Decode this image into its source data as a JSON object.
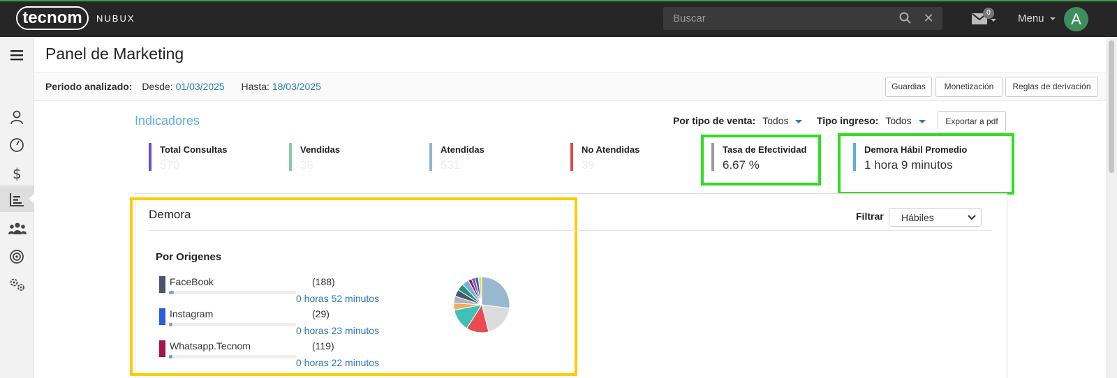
{
  "brand": {
    "logo": "tecnom",
    "product": "NUBUX"
  },
  "topbar": {
    "search_placeholder": "Buscar",
    "mail_count": "0",
    "menu_label": "Menu",
    "avatar_initial": "A"
  },
  "page": {
    "title": "Panel de Marketing"
  },
  "period": {
    "label": "Periodo analizado:",
    "from_label": "Desde:",
    "from_value": "01/03/2025",
    "to_label": "Hasta:",
    "to_value": "18/03/2025"
  },
  "actions": {
    "guardias": "Guardias",
    "monetizacion": "Monetización",
    "reglas": "Reglas de derivación"
  },
  "indicators": {
    "title": "Indicadores",
    "filter_sale_label": "Por tipo de venta:",
    "filter_sale_value": "Todos",
    "filter_income_label": "Tipo ingreso:",
    "filter_income_value": "Todos",
    "export_label": "Exportar a pdf",
    "kpis": [
      {
        "label": "Total Consultas",
        "value": "570",
        "color": "#6a4fc9"
      },
      {
        "label": "Vendidas",
        "value": "38",
        "color": "#8cc9a8"
      },
      {
        "label": "Atendidas",
        "value": "531",
        "color": "#8fb4d8"
      },
      {
        "label": "No Atendidas",
        "value": "39",
        "color": "#e0474c"
      },
      {
        "label": "Tasa de Efectividad",
        "value": "6.67 %",
        "color": "#999999"
      },
      {
        "label": "Demora Hábil Promedio",
        "value": "1 hora 9 minutos",
        "color": "#5aaedb"
      }
    ]
  },
  "demora": {
    "title": "Demora",
    "filter_label": "Filtrar",
    "filter_value": "Hábiles",
    "origins_title": "Por Origenes",
    "origins": [
      {
        "name": "FaceBook",
        "count": "(188)",
        "time": "0 horas 52 minutos",
        "color": "#4a5568",
        "level": 0.04
      },
      {
        "name": "Instagram",
        "count": "(29)",
        "time": "0 horas 23 minutos",
        "color": "#2b5fd9",
        "level": 0.03
      },
      {
        "name": "Whatsapp.Tecnom",
        "count": "(119)",
        "time": "0 horas 22 minutos",
        "color": "#a0154a",
        "level": 0.03
      }
    ],
    "pie_share": [
      0.27,
      0.19,
      0.13,
      0.13,
      0.04,
      0.04,
      0.04,
      0.04,
      0.04,
      0.02,
      0.02,
      0.02,
      0.02
    ],
    "pie_colors": [
      "#97b9cf",
      "#dcdcdc",
      "#ea4a53",
      "#3ec0b7",
      "#f2a95b",
      "#aab2bc",
      "#4a5568",
      "#2c8f7a",
      "#6ab6e0",
      "#a0154a",
      "#7857c2",
      "#2b5fd9",
      "#f7d84a"
    ]
  }
}
